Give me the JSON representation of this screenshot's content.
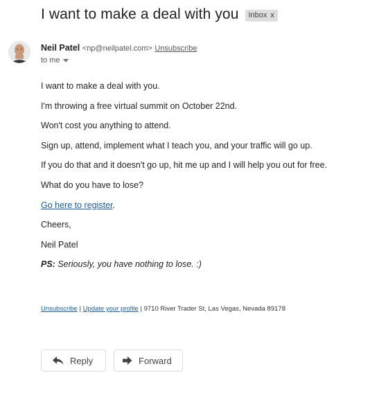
{
  "email": {
    "subject": "I want to make a deal with you",
    "label": "Inbox",
    "label_remove": "x",
    "sender_name": "Neil Patel",
    "sender_email": "<np@neilpatel.com>",
    "unsubscribe": "Unsubscribe",
    "to": "to me",
    "body": [
      "I want to make a deal with you.",
      "I'm throwing a free virtual summit on October 22nd.",
      "Won't cost you anything to attend.",
      "Sign up, attend, implement what I teach you, and your traffic will go up.",
      "If you do that and it doesn't go up, hit me up and I will help you out for free.",
      "What do you have to lose?"
    ],
    "link_text": "Go here to register",
    "link_suffix": ".",
    "closing": "Cheers,",
    "signature": "Neil Patel",
    "ps_label": "PS:",
    "ps_text": "Seriously, you have nothing to lose. :)"
  },
  "footer": {
    "unsubscribe": "Unsubscribe",
    "sep1": " | ",
    "update_profile": "Update your profile",
    "sep2": " | ",
    "address": "9710 River Trader St, Las Vegas, Nevada 89178"
  },
  "actions": {
    "reply": "Reply",
    "forward": "Forward"
  },
  "icons": {
    "avatar": "avatar-photo",
    "reply": "reply-arrow-icon",
    "forward": "forward-arrow-icon",
    "caret": "caret-down-icon"
  }
}
